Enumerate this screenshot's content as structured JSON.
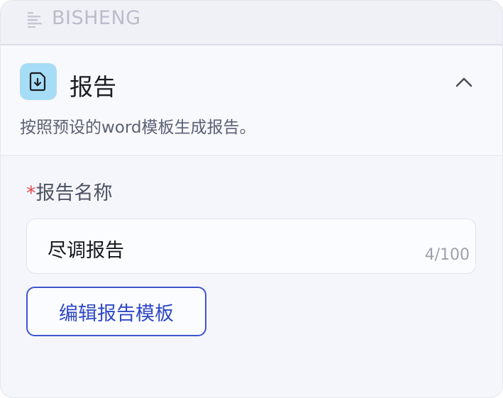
{
  "brand": {
    "name": "BISHENG",
    "icon": "text-lines-icon"
  },
  "node": {
    "icon": "file-download-icon",
    "title": "报告",
    "description": "按照预设的word模板生成报告。",
    "collapse_icon": "chevron-up-icon"
  },
  "field": {
    "required_mark": "*",
    "label": "报告名称",
    "value": "尽调报告",
    "counter": "4/100"
  },
  "actions": {
    "edit_template_label": "编辑报告模板"
  },
  "colors": {
    "accent": "#3d55cf",
    "icon_bg": "#a7dcf6",
    "required": "#e5484d"
  }
}
